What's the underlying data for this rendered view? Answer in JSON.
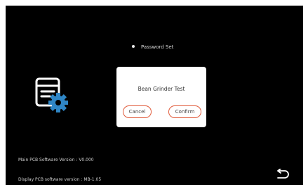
{
  "menu": {
    "items": [
      {
        "label": "Password Set"
      },
      {
        "label": ""
      }
    ]
  },
  "dialog": {
    "title": "Bean Grinder Test",
    "cancel_label": "Cancel",
    "confirm_label": "Confirm"
  },
  "footer": {
    "main_version": "Main PCB Software Version : V0.000",
    "display_version": "Display PCB software version : MB-1.05"
  },
  "icons": {
    "settings": "settings-document-gear-icon",
    "back": "back-arrow-icon"
  },
  "colors": {
    "screen_background": "#000000",
    "dialog_background": "#ffffff",
    "button_border": "#e05a3a",
    "icon_blue": "#2f86c6",
    "icon_white": "#ffffff"
  }
}
